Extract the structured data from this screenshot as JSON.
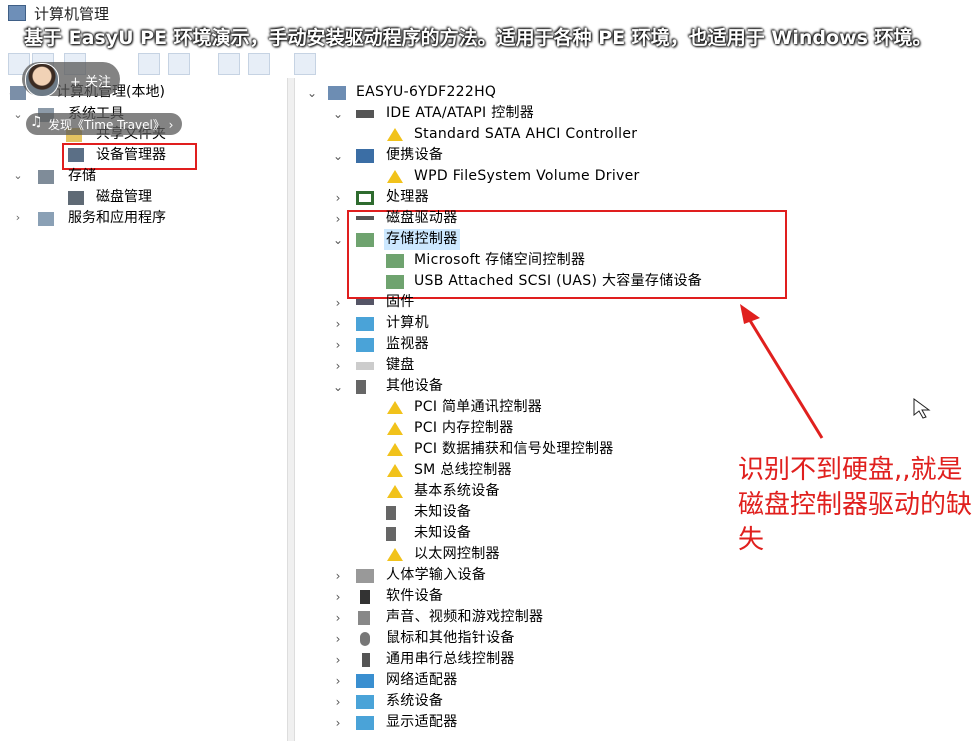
{
  "window": {
    "title": "计算机管理"
  },
  "overlay": {
    "caption": "基于 EasyU PE 环境演示，手动安装驱动程序的方法。适用于各种 PE 环境，也适用于 Windows 环境。",
    "follow_label": "+ 关注",
    "music_label": "发现《Time Travel》 ›"
  },
  "left_tree": {
    "root": "计算机管理(本地)",
    "system_tools": "系统工具",
    "shared_folders": "共享文件夹",
    "device_manager": "设备管理器",
    "storage": "存储",
    "disk_management": "磁盘管理",
    "services_apps": "服务和应用程序"
  },
  "device_tree": {
    "computer_name": "EASYU-6YDF222HQ",
    "ide": "IDE ATA/ATAPI 控制器",
    "sata": "Standard SATA AHCI Controller",
    "portable": "便携设备",
    "wpd": "WPD FileSystem Volume Driver",
    "processor": "处理器",
    "disk_drives": "磁盘驱动器",
    "storage_controllers": "存储控制器",
    "ms_storage": "Microsoft 存储空间控制器",
    "usb_scsi": "USB Attached SCSI (UAS) 大容量存储设备",
    "firmware": "固件",
    "computer": "计算机",
    "monitors": "监视器",
    "keyboards": "键盘",
    "other_devices": "其他设备",
    "pci_comm": "PCI 简单通讯控制器",
    "pci_mem": "PCI 内存控制器",
    "pci_data": "PCI 数据捕获和信号处理控制器",
    "sm_bus": "SM 总线控制器",
    "base_sys": "基本系统设备",
    "unknown1": "未知设备",
    "unknown2": "未知设备",
    "ethernet": "以太网控制器",
    "hid": "人体学输入设备",
    "software": "软件设备",
    "sound": "声音、视频和游戏控制器",
    "mice": "鼠标和其他指针设备",
    "usb": "通用串行总线控制器",
    "network": "网络适配器",
    "system": "系统设备",
    "display": "显示适配器"
  },
  "annotation": "识别不到硬盘,,就是磁盘控制器驱动的缺失",
  "colors": {
    "accent_red": "#e01e1e",
    "warning_yellow": "#f1c21b"
  }
}
